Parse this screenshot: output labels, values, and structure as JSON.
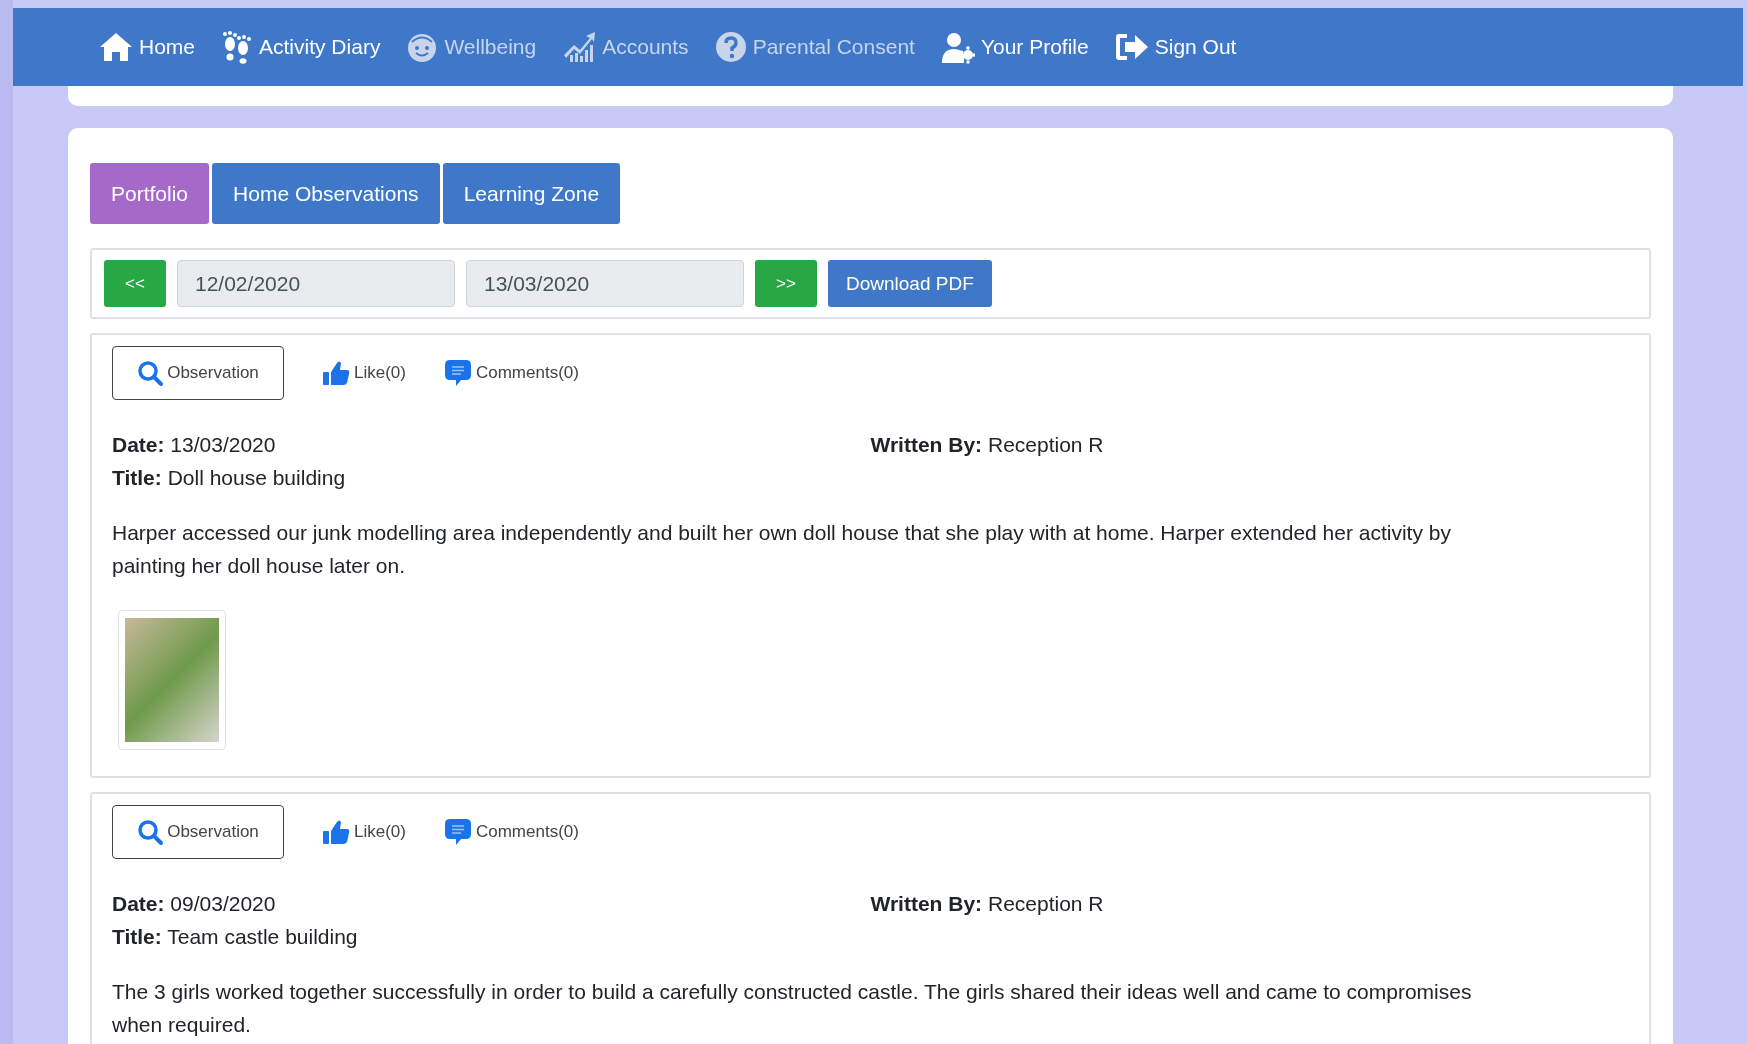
{
  "nav": [
    {
      "label": "Home",
      "kind": "home",
      "dimmed": false
    },
    {
      "label": "Activity Diary",
      "kind": "feet",
      "dimmed": false
    },
    {
      "label": "Wellbeing",
      "kind": "face",
      "dimmed": true
    },
    {
      "label": "Accounts",
      "kind": "chart",
      "dimmed": true
    },
    {
      "label": "Parental Consent",
      "kind": "question",
      "dimmed": true
    },
    {
      "label": "Your Profile",
      "kind": "profile",
      "dimmed": false
    },
    {
      "label": "Sign Out",
      "kind": "signout",
      "dimmed": false
    }
  ],
  "tabs": [
    {
      "label": "Portfolio",
      "selected": true
    },
    {
      "label": "Home Observations",
      "selected": false
    },
    {
      "label": "Learning Zone",
      "selected": false
    }
  ],
  "filter": {
    "prev": "<<",
    "start_date": "12/02/2020",
    "end_date": "13/03/2020",
    "next": ">>",
    "download": "Download PDF"
  },
  "observations": [
    {
      "type": "Observation",
      "like": "Like(0)",
      "comments": "Comments(0)",
      "date": "**Date:** 13/03/2020",
      "author": "**Written By:** Reception R",
      "title": "**Title:** Doll house building",
      "text": "Harper accessed our junk modelling area independently and built her own doll house that she play with at home. Harper extended her activity by painting her doll house later on."
    },
    {
      "type": "Observation",
      "like": "Like(0)",
      "comments": "Comments(0)",
      "date": "**Date:** 09/03/2020",
      "author": "**Written By:** Reception R",
      "title": "**Title:** Team castle building",
      "text": "The 3 girls worked together successfully in order to build a carefully constructed castle. The girls shared their ideas well and came to compromises when required."
    }
  ]
}
